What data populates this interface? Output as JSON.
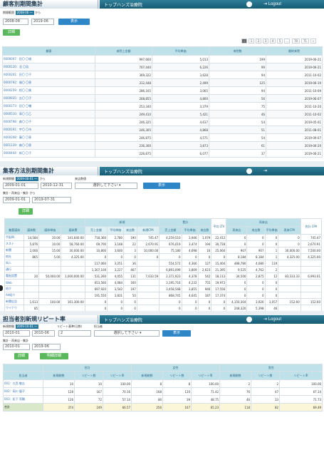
{
  "p1": {
    "title": "顧客別期間集計",
    "clinic": "トップハンズ治療院",
    "logout": "Logout",
    "period_label": "期間範囲",
    "tag": "2008-06 〜",
    "kara": "から",
    "from": "2008-08",
    "to": "2019-06",
    "show": "表示",
    "csv": "詳細",
    "pages": [
      "1",
      "2",
      "3",
      "4",
      "5",
      "…",
      "70",
      "71",
      "»"
    ],
    "cols": [
      "顧客",
      "来院上金額",
      "平均単価",
      "来院数",
      "最終来院"
    ],
    "rows": [
      [
        "0000007：田〇 〇雄",
        "997,660",
        "5,013",
        "199",
        "2019-06-21"
      ],
      [
        "0000120：北 〇浩",
        "707,440",
        "6,226",
        "99",
        "2019-06-21"
      ],
      [
        "0000201：田〇 〇子",
        "369,322",
        "3,628",
        "94",
        "2011-10-02"
      ],
      [
        "0000792：福〇 〇恵",
        "312,448",
        "2,499",
        "125",
        "2019-06-19"
      ],
      [
        "0000259：相〇 〇美",
        "286,165",
        "3,065",
        "94",
        "2011-10-09"
      ],
      [
        "0000935：吉〇 〇子",
        "268,855",
        "4,800",
        "56",
        "2019-06-07"
      ],
      [
        "0000173：田〇 〇輔",
        "253,340",
        "3,379",
        "75",
        "2011-10-20"
      ],
      [
        "0000510：高〇 〇乙",
        "249,410",
        "5,421",
        "46",
        "2011-10-02"
      ],
      [
        "0000798：森〇 〇子",
        "246,325",
        "4,617",
        "54",
        "2019-05-01"
      ],
      [
        "0000191：宇〇 〇市",
        "246,305",
        "4,868",
        "51",
        "2011-08-01"
      ],
      [
        "0000208：藤〇 〇恵",
        "246,875",
        "4,571",
        "54",
        "2019-09-07"
      ],
      [
        "0001139：森〇 〇恵",
        "236,300",
        "3,873",
        "61",
        "2019-06-20"
      ],
      [
        "0000444：新〇 〇子",
        "226,875",
        "6,077",
        "37",
        "2019-06-21"
      ]
    ]
  },
  "p2": {
    "title": "集客方法別期間集計",
    "clinic": "トップハンズ治療院",
    "l1": "新規期間",
    "tag": "2009-06-01 〜",
    "kara": "から",
    "l2": "来店数値",
    "from": "2009-01-01",
    "to": "2010-12-31",
    "select": "選択して下さい ▾",
    "show": "表示",
    "l3": "集計・再来店・集計",
    "kara2": "から",
    "from2": "2009-01-01",
    "to2": "2019-07-31",
    "csv": "詳細",
    "groups": [
      "新規",
      "累計",
      "平均\nLTV",
      "再来店",
      "合計\nCPA"
    ],
    "cols": [
      "集客媒体",
      "媒体数",
      "媒体単価",
      "媒体費",
      "売上金額",
      "平均単価",
      "来店数",
      "新規CPA",
      "売上金額",
      "平均単価",
      "来店数",
      "",
      "再来店",
      "来店数",
      "平均単価",
      "再来CPA",
      ""
    ],
    "rows": [
      [
        "手配IN",
        "14,584",
        "10.00",
        "141,640.00",
        "718,360",
        "2,780",
        "190",
        "745.47",
        "4,259,510",
        "3,946",
        "1,079",
        "22,412",
        "0",
        "0",
        "0",
        "0",
        "745.47"
      ],
      [
        "ネスト",
        "5,876",
        "10.00",
        "58,760.00",
        "69,700",
        "3,168",
        "22",
        "2,670.91",
        "676,019",
        "3,474",
        "194",
        "30,728",
        "0",
        "0",
        "0",
        "0",
        "2,670.91"
      ],
      [
        "新聞",
        "2,000",
        "15.00",
        "30,000.00",
        "10,800",
        "3,600",
        "3",
        "10,000.00",
        "75,180",
        "4,698",
        "16",
        "25,060",
        "907",
        "907",
        "1",
        "30,000.00",
        "7,500.00"
      ],
      [
        "他社",
        "865",
        "5.00",
        "4,325.00",
        "0",
        "0",
        "0",
        "0",
        "0",
        "0",
        "0",
        "0",
        "8,184",
        "8,184",
        "1",
        "4,325.00",
        "4,325.00"
      ],
      [
        "知人",
        "",
        "",
        "",
        "117,060",
        "3,251",
        "36",
        "",
        "554,572",
        "4,366",
        "127",
        "15,404",
        "488,780",
        "4,080",
        "119",
        "",
        ""
      ],
      [
        "通行",
        "",
        "",
        "",
        "1,307,100",
        "3,227",
        "467",
        "",
        "6,893,099",
        "3,809",
        "2,623",
        "21,395",
        "9,525",
        "4,762",
        "2",
        "",
        ""
      ],
      [
        "看板設置",
        "20",
        "50,000.00",
        "1,000,000.00",
        "531,260",
        "4,055",
        "131",
        "7,633.59",
        "2,372,923",
        "4,378",
        "542",
        "18,113",
        "34,500",
        "2,875",
        "12",
        "83,333.33",
        "6,993.01"
      ],
      [
        "Web",
        "",
        "",
        "",
        "653,560",
        "4,084",
        "160",
        "",
        "3,195,716",
        "4,232",
        "755",
        "19,973",
        "0",
        "0",
        "0",
        "",
        ""
      ],
      [
        "紹介",
        "",
        "",
        "",
        "697,920",
        "3,542",
        "197",
        "",
        "3,458,568",
        "3,855",
        "946",
        "17,556",
        "0",
        "0",
        "0",
        "",
        ""
      ],
      [
        "Ad紹介",
        "",
        "",
        "",
        "191,550",
        "3,831",
        "50",
        "",
        "868,745",
        "4,645",
        "187",
        "17,374",
        "0",
        "0",
        "0",
        "",
        ""
      ],
      [
        "新聞広告",
        "1,613",
        "100.00",
        "161,300.00",
        "0",
        "0",
        "0",
        "",
        "0",
        "0",
        "0",
        "0",
        "4,150,304",
        "3,926",
        "1,057",
        "152.60",
        "152.60"
      ],
      [
        "ワイナウ",
        "85",
        "",
        "",
        "0",
        "0",
        "0",
        "",
        "0",
        "0",
        "0",
        "0",
        "248,320",
        "5,398",
        "46",
        "",
        ""
      ],
      [
        "美sRun",
        "83",
        "",
        "",
        "0",
        "0",
        "0",
        "",
        "0",
        "0",
        "0",
        "0",
        "67,000",
        "5,153",
        "13",
        "",
        ""
      ]
    ]
  },
  "p3": {
    "title": "担当者別新規リピート率",
    "clinic": "トップハンズ治療院",
    "logout": "Logout",
    "l1": "新規期間",
    "tag": "2009-10-01 〜",
    "l2": "リピート基準(日数)",
    "l3": "担当者",
    "from": "2010-01",
    "to": "2010-06",
    "days": "2",
    "select": "選択して下さい ▾",
    "show": "表示",
    "l4": "集計・再来店・集計",
    "kara": "から",
    "from2": "2010-01",
    "to2": "2019-06",
    "csv": "詳細",
    "csv2": "明細詳細",
    "groups": [
      "合計",
      "女性",
      "男性"
    ],
    "cols": [
      "担当者",
      "新規総数",
      "リピート数",
      "リピート率",
      "新規総数",
      "リピート数",
      "リピート率",
      "新規総数",
      "リピート数",
      "リピート率"
    ],
    "rows": [
      [
        "001：大西 敬吉",
        "10",
        "10",
        "100.00",
        "8",
        "8",
        "100.00",
        "2",
        "2",
        "100.00"
      ],
      [
        "002：岡川 優子",
        "128",
        "167",
        "70.16",
        "168",
        "120",
        "71.42",
        "76",
        "47",
        "67.14"
      ],
      [
        "003：松下 亮輔",
        "126",
        "72",
        "57.14",
        "80",
        "39",
        "48.75",
        "46",
        "33",
        "71.73"
      ]
    ],
    "total": [
      "合計",
      "374",
      "249",
      "66.57",
      "256",
      "167",
      "65.23",
      "118",
      "82",
      "69.49"
    ]
  }
}
